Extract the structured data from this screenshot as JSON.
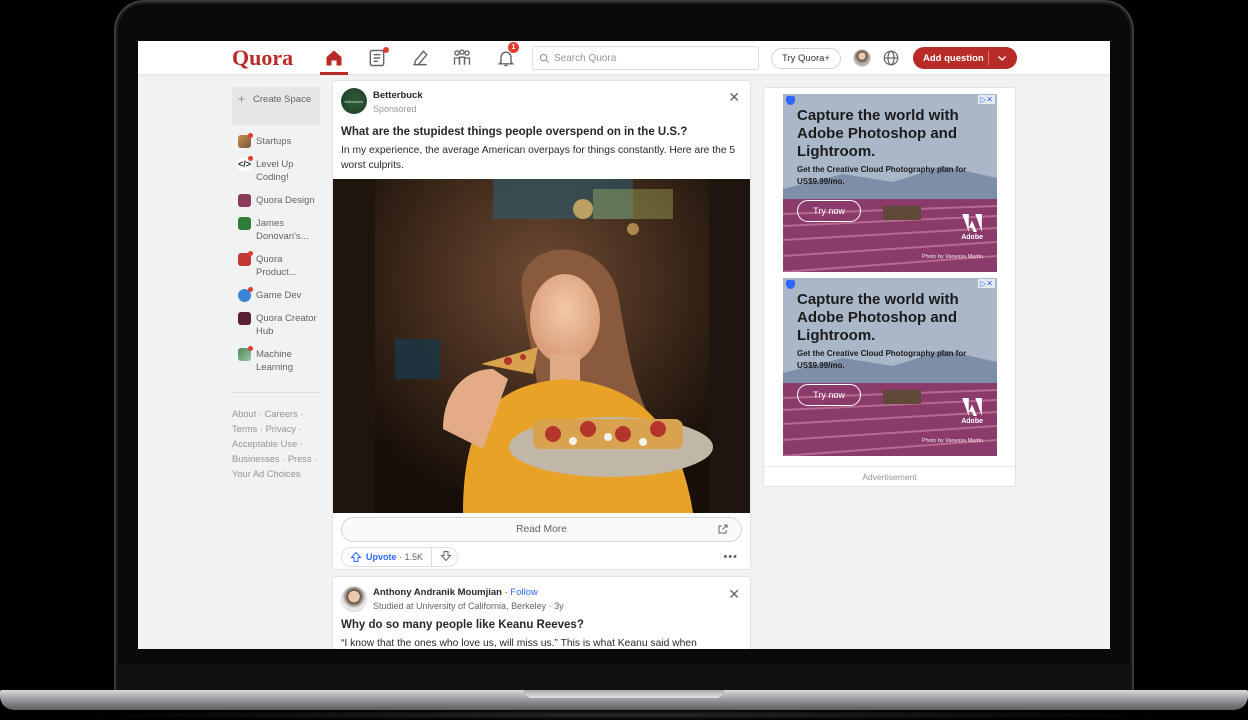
{
  "header": {
    "logo": "Quora",
    "notification_count": "1",
    "search_placeholder": "Search Quora",
    "try_label": "Try Quora+",
    "add_question_label": "Add question",
    "accent_color": "#b92b27"
  },
  "sidebar": {
    "create_space_label": "Create Space",
    "items": [
      {
        "label": "Startups",
        "icon": "startups-icon"
      },
      {
        "label": "Level Up Coding!",
        "icon": "code-icon"
      },
      {
        "label": "Quora Design",
        "icon": "quora-design-icon"
      },
      {
        "label": "James Donovan's...",
        "icon": "james-donovan-icon"
      },
      {
        "label": "Quora Product...",
        "icon": "quora-product-icon"
      },
      {
        "label": "Game Dev",
        "icon": "game-dev-icon"
      },
      {
        "label": "Quora Creator Hub",
        "icon": "creator-hub-icon"
      },
      {
        "label": "Machine Learning",
        "icon": "machine-learning-icon"
      }
    ],
    "footer_links": [
      "About",
      "Careers",
      "Terms",
      "Privacy",
      "Acceptable Use",
      "Businesses",
      "Press",
      "Your Ad Choices"
    ]
  },
  "feed": {
    "ad_post": {
      "author": "Betterbuck",
      "author_logo_text": "betterbuck",
      "label": "Sponsored",
      "title": "What are the stupidest things people overspend on in the U.S.?",
      "body": "In my experience, the average American overpays for things constantly. Here are the 5 worst culprits.",
      "read_more_label": "Read More",
      "upvote_label": "Upvote",
      "upvote_count": "1.5K"
    },
    "answer_post": {
      "author": "Anthony Andranik Moumjian",
      "follow_label": "Follow",
      "credential": "Studied at University of California, Berkeley · 3y",
      "title": "Why do so many people like Keanu Reeves?",
      "excerpt": "“I know that the ones who love us, will miss us.” This is what Keanu said when"
    }
  },
  "ads": {
    "headline": "Capture the world with Adobe Photoshop and Lightroom.",
    "subline": "Get the Creative Cloud Photography plan for US$9.99/mo.",
    "cta": "Try now",
    "brand": "Adobe",
    "photo_credit": "Photo by Vanessa Martin",
    "footer_label": "Advertisement"
  }
}
